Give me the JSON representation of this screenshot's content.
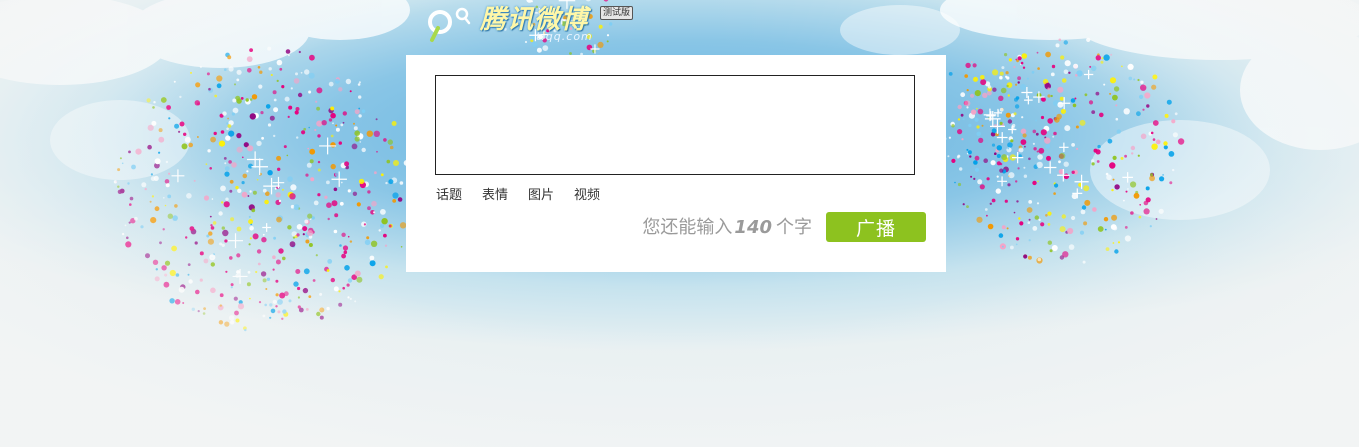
{
  "brand": {
    "name": "腾讯微博",
    "domain": "t.qq.com",
    "badge": "测试版"
  },
  "composer": {
    "text_value": "",
    "placeholder": ""
  },
  "toolbar": {
    "items": [
      {
        "label": "话题",
        "icon": "topic-icon"
      },
      {
        "label": "表情",
        "icon": "emoji-icon"
      },
      {
        "label": "图片",
        "icon": "image-icon"
      },
      {
        "label": "视频",
        "icon": "video-icon"
      }
    ]
  },
  "counter": {
    "prefix": "您还能输入",
    "remaining": "140",
    "suffix": "个字"
  },
  "send_button": {
    "label": "广播",
    "color": "#8dc21f"
  },
  "colors": {
    "sky": "#56acde",
    "panel": "#ffffff",
    "accent": "#8dc21f"
  }
}
